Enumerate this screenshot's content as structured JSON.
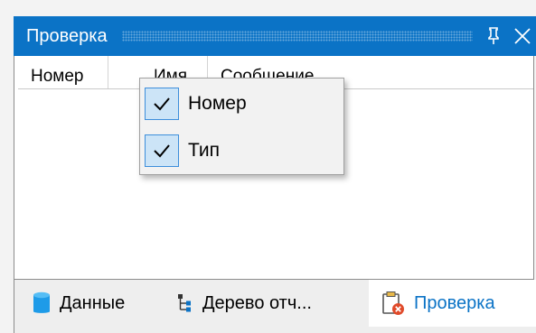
{
  "panel": {
    "title": "Проверка",
    "pin_icon": "pin-icon",
    "close_icon": "close-icon"
  },
  "grid": {
    "columns": [
      "Номер",
      "Имя",
      "Сообщение"
    ]
  },
  "context_menu": {
    "items": [
      {
        "label": "Номер",
        "checked": true
      },
      {
        "label": "Тип",
        "checked": true
      }
    ]
  },
  "bottom_tabs": [
    {
      "label": "Данные",
      "icon": "database-icon",
      "active": false
    },
    {
      "label": "Дерево отч...",
      "icon": "tree-icon",
      "active": false
    },
    {
      "label": "Проверка",
      "icon": "clipboard-error-icon",
      "active": true
    }
  ],
  "colors": {
    "accent": "#0b73c6",
    "menu_check_bg": "#cce4f7",
    "error": "#e04a2a"
  }
}
